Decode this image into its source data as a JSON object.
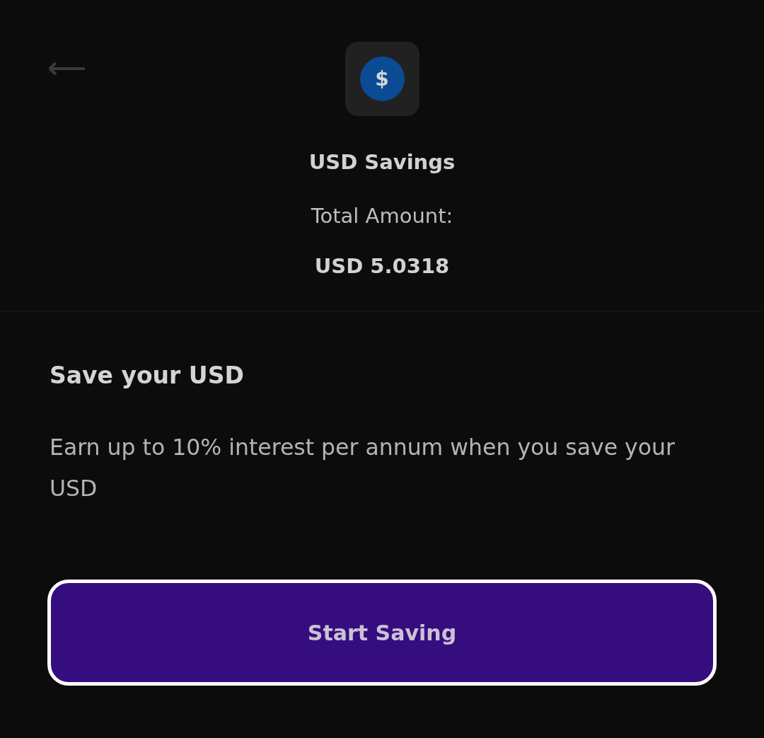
{
  "header": {
    "currency_symbol": "$",
    "title": "USD Savings",
    "total_label": "Total Amount:",
    "total_value": "USD 5.0318"
  },
  "section": {
    "heading": "Save your USD",
    "description": "Earn up to 10% interest per annum when you save your USD"
  },
  "primary_button": {
    "label": "Start Saving",
    "focused": true
  }
}
